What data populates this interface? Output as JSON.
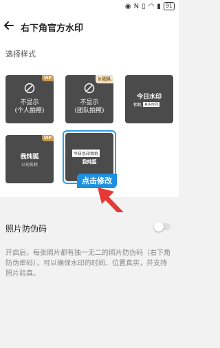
{
  "status": {
    "battery": "91"
  },
  "header": {
    "title": "右下角官方水印"
  },
  "section_label": "选择样式",
  "cards": [
    {
      "badge": "VIP",
      "line1": "不显示",
      "line2": "(个人拍照)"
    },
    {
      "badge": "团队",
      "line1": "不显示",
      "line2": "(团队拍照)"
    },
    {
      "title": "今日水印",
      "chip_left": "相机",
      "chip_right": "真实时间"
    },
    {
      "badge": "VIP",
      "brand": "我炖狐",
      "company": "公司名称"
    },
    {
      "chip": "今日水印相机",
      "name": "我炖狐"
    }
  ],
  "edit_button": "点击修改",
  "toggle": {
    "label": "照片防伪码",
    "on": false
  },
  "description": "开启后，每张照片都有独一无二的照片防伪码（右下角防伪串码），可以确保水印的时间、位置真实，并支持照片验真。",
  "colors": {
    "accent": "#1e90e0",
    "vip": "#c79a53",
    "arrow": "#e53935"
  }
}
